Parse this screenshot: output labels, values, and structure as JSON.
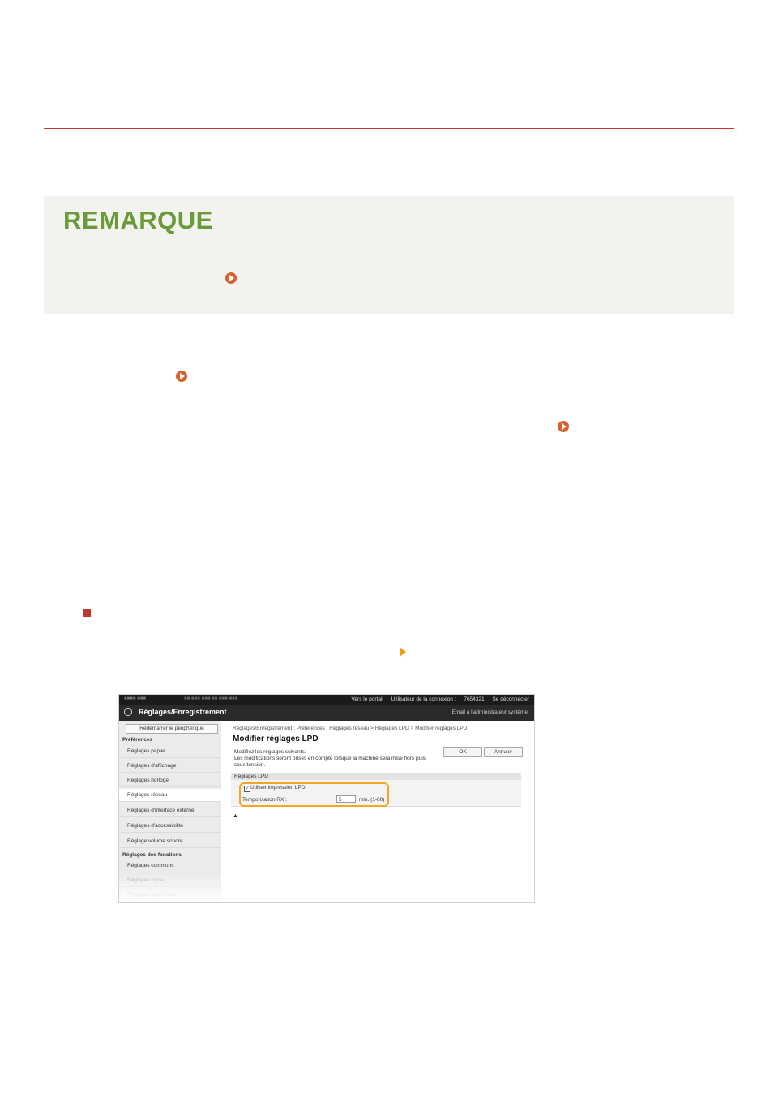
{
  "document": {
    "note_title": "REMARQUE"
  },
  "screenshot": {
    "topbar": {
      "portal_link": "Vers le portail",
      "login_user_label": "Utilisateur de la connexion :",
      "login_user_value": "7654321",
      "logout_link": "Se déconnecter"
    },
    "titlebar": {
      "title": "Réglages/Enregistrement",
      "admin_mail": "Email à l'administrateur système"
    },
    "sidebar": {
      "restart_button": "Redémarrer le périphérique",
      "section_preferences": "Préférences",
      "items_preferences": [
        "Réglages papier",
        "Réglages d'affichage",
        "Réglages horloge",
        "Réglages réseau",
        "Réglages d'interface externe",
        "Réglages d'accessibilité",
        "Réglage volume sonore"
      ],
      "section_functions": "Réglages des fonctions",
      "items_functions": [
        "Réglages communs",
        "Réglages copie",
        "Réglages imprimante"
      ]
    },
    "main": {
      "breadcrumb": "Réglages/Enregistrement : Préférences : Réglages réseau > Réglages LPD > Modifier réglages LPD",
      "page_title": "Modifier réglages LPD",
      "desc_line1": "Modifiez les réglages suivants.",
      "desc_line2": "Les modifications seront prises en compte lorsque la machine sera mise hors puis sous tension.",
      "ok_button": "OK",
      "cancel_button": "Annuler",
      "section_header": "Réglages LPD",
      "use_lpd_label": "Utiliser impression LPD",
      "use_lpd_checked": true,
      "rx_timeout_label": "Temporisation RX :",
      "rx_timeout_value": "5",
      "rx_timeout_unit": "min. (1-60)",
      "top_link": "▲"
    }
  },
  "colors": {
    "rule": "#c0392b",
    "note_title": "#6a9a3a",
    "link_icon": "#d9602f",
    "highlight": "#f5a623"
  }
}
